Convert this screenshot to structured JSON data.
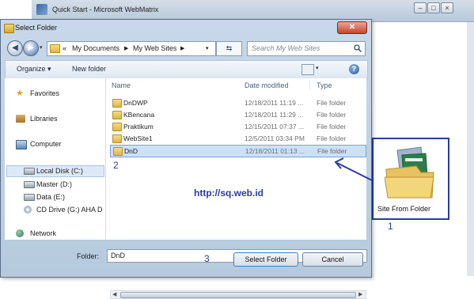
{
  "bg_window": {
    "title": "Quick Start - Microsoft WebMatrix"
  },
  "dialog": {
    "title": "Select Folder",
    "address": {
      "segments": [
        "«",
        "My Documents",
        "My Web Sites"
      ]
    },
    "search_placeholder": "Search My Web Sites",
    "toolbar": {
      "organize": "Organize ▾",
      "new_folder": "New folder"
    },
    "nav": {
      "items": [
        {
          "label": "Favorites"
        },
        {
          "label": "Libraries"
        },
        {
          "label": "Computer"
        },
        {
          "label": "Local Disk (C:)"
        },
        {
          "label": "Master (D:)"
        },
        {
          "label": "Data (E:)"
        },
        {
          "label": "CD Drive (G:) AHA D"
        },
        {
          "label": "Network"
        }
      ]
    },
    "columns": {
      "name": "Name",
      "date": "Date modified",
      "type": "Type"
    },
    "files": [
      {
        "name": "DnDWP",
        "date": "12/18/2011 11:19 ...",
        "type": "File folder"
      },
      {
        "name": "KBencana",
        "date": "12/18/2011 11:29 ...",
        "type": "File folder"
      },
      {
        "name": "Praktikum",
        "date": "12/15/2011 07:37 ...",
        "type": "File folder"
      },
      {
        "name": "WebSite1",
        "date": "12/5/2011 03:34 PM",
        "type": "File folder"
      },
      {
        "name": "DnD",
        "date": "12/18/2011 01:13 ...",
        "type": "File folder"
      }
    ],
    "folder_label": "Folder:",
    "folder_value": "DnD",
    "select_button": "Select Folder",
    "cancel_button": "Cancel"
  },
  "annotations": {
    "n1": "1",
    "n2": "2",
    "n3": "3",
    "url": "http://sq.web.id"
  },
  "site_from_folder": {
    "label": "Site From Folder"
  },
  "colors": {
    "annotation": "#2a3ba0",
    "selection": "#cce0f7"
  }
}
